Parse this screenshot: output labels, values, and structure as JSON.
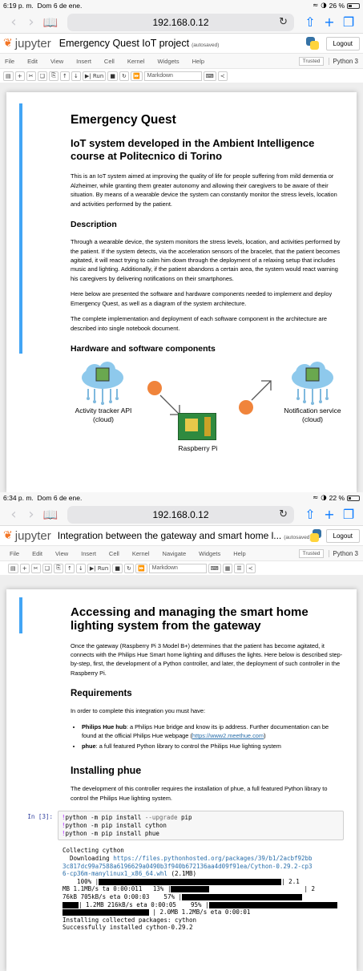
{
  "shot1": {
    "status": {
      "time": "6:19 p. m.",
      "date": "Dom 6 de ene.",
      "battery": "26 %",
      "battery_level": 0.26
    },
    "url": "192.168.0.12",
    "notebook": {
      "title": "Emergency Quest IoT project",
      "autosave": "(autosaved)",
      "logout": "Logout",
      "trusted": "Trusted",
      "kernel": "Python 3"
    },
    "menu": [
      "File",
      "Edit",
      "View",
      "Insert",
      "Cell",
      "Kernel",
      "Widgets",
      "Help"
    ],
    "toolbar": {
      "run": "Run",
      "celltype": "Markdown"
    },
    "content": {
      "h1": "Emergency Quest",
      "h2": "IoT system developed in the Ambient Intelligence course at Politecnico di Torino",
      "p1": "This is an IoT system aimed at improving the quality of life for people suffering from mild dementia or Alzheimer, while granting them greater autonomy and allowing their caregivers to be aware of their situation. By means of a wearable device the system can constantly monitor the stress levels, location and activities performed by the patient.",
      "h3_desc": "Description",
      "p2": "Through a wearable device, the system monitors the stress levels, location, and activities performed by the patient. If the system detects, via the acceleration sensors of the bracelet, that the patient becomes agitated, it will react trying to calm him down through the deployment of a relaxing setup that includes music and lighting. Additionally, if the patient abandons a certain area, the system would react warning his caregivers by delivering notifications on their smartphones.",
      "p3": "Here below are presented the software and hardware components needed to implement and deploy Emergency Quest, as well as a diagram of the system architecture.",
      "p4": "The complete implementation and deployment of each software component in the architecture are described into single notebook document.",
      "h3_hw": "Hardware and software components",
      "diagram": {
        "left": "Activity tracker API\n(cloud)",
        "right": "Notification service\n(cloud)",
        "center": "Raspberry Pi"
      }
    }
  },
  "shot2": {
    "status": {
      "time": "6:34 p. m.",
      "date": "Dom 6 de ene.",
      "battery": "22 %",
      "battery_level": 0.22
    },
    "url": "192.168.0.12",
    "notebook": {
      "title": "Integration between the gateway and smart home l...",
      "autosave": "(autosaved)",
      "logout": "Logout",
      "trusted": "Trusted",
      "kernel": "Python 3"
    },
    "menu": [
      "File",
      "Edit",
      "View",
      "Insert",
      "Cell",
      "Kernel",
      "Navigate",
      "Widgets",
      "Help"
    ],
    "toolbar": {
      "run": "Run",
      "celltype": "Markdown"
    },
    "content": {
      "h1": "Accessing and managing the smart home lighting system from the gateway",
      "p1": "Once the gateway (Raspberry Pi 3 Model B+) determines that the patient has become agitated, it connects with the Philips Hue Smart home lighting and diffuses the lights. Here below is described step-by-step, first, the development of a Python controller, and later, the deployment of such controller in the Raspberry Pi.",
      "h2_req": "Requirements",
      "p_req": "In order to complete this integration you must have:",
      "li1_bold": "Philips Hue hub",
      "li1_text": ": a Philips Hue bridge and know its ip address. Further documentation can be found at the official Philips Hue webpage (",
      "li1_link": "https://www2.meethue.com",
      "li1_end": ")",
      "li2_bold": "phue",
      "li2_text": ": a full featured Python library to control the Philips Hue lighting system",
      "h2_inst": "Installing phue",
      "p_inst": "The development of this controller requires the installation of phue, a full featured Python library to control the Philips Hue lighting system.",
      "prompt": "In [3]:",
      "code": [
        {
          "bang": "!",
          "cmd": "python -m pip install ",
          "flag": "--upgrade",
          "rest": " pip"
        },
        {
          "bang": "!",
          "cmd": "python -m pip install cython",
          "flag": "",
          "rest": ""
        },
        {
          "bang": "!",
          "cmd": "python -m pip install phue",
          "flag": "",
          "rest": ""
        }
      ],
      "out": {
        "l1": "Collecting cython",
        "l2": "  Downloading ",
        "link": "https://files.pythonhosted.org/packages/39/b1/2acbf92bb\n3c817dc99a7588a6196629a0490b3f940b672136aa4d09f91ea/Cython-0.29.2-cp3\n6-cp36m-manylinux1_x86_64.whl",
        "l2b": " (2.1MB)",
        "p1a": "    100% |",
        "p1b": "| 2.1",
        "p2a": "MB 1.1MB/s ta 0:00:011   13% |",
        "p2b": "| 2",
        "p3a": "76kB 705kB/s eta 0:00:03    57% |",
        "p4a": "| 1.2MB 216kB/s eta 0:00:05    95% |",
        "p5b": " | 2.0MB 1.2MB/s eta 0:00:01",
        "l6": "Installing collected packages: cython",
        "l7": "Successfully installed cython-0.29.2"
      }
    }
  }
}
